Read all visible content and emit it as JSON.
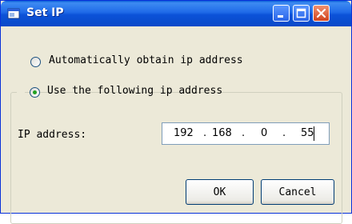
{
  "window": {
    "title": "Set IP",
    "icon": "app-window-icon",
    "controls": [
      "minimize-icon",
      "maximize-icon",
      "close-icon"
    ]
  },
  "options": {
    "auto_label": "Automatically obtain ip address",
    "auto_selected": false,
    "manual_label": "Use the following ip address",
    "manual_selected": true
  },
  "ip": {
    "label": "IP address:",
    "octet1": "192",
    "octet2": "168",
    "octet3": "0",
    "octet4": "55"
  },
  "buttons": {
    "ok_label": "OK",
    "cancel_label": "Cancel"
  },
  "colors": {
    "title_bar": "#0b52d8",
    "close_button": "#d2441e",
    "radio_selected": "#21a121",
    "dialog_background": "#ece9d8"
  }
}
